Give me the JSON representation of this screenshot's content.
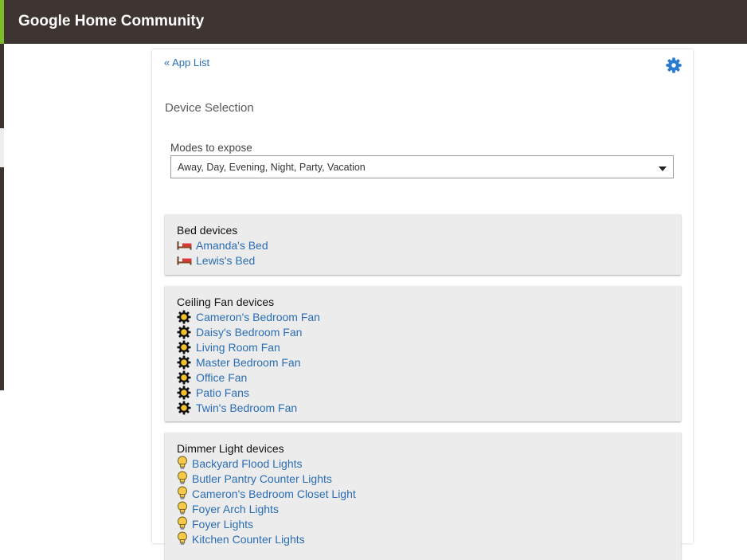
{
  "header": {
    "title": "Google Home Community"
  },
  "panel": {
    "back_link": "« App List",
    "section_title": "Device Selection",
    "modes": {
      "label": "Modes to expose",
      "value": "Away, Day, Evening, Night, Party, Vacation"
    }
  },
  "groups": {
    "bed": {
      "title": "Bed devices",
      "icon": "bed-icon",
      "items": [
        "Amanda's Bed",
        "Lewis's Bed"
      ]
    },
    "fan": {
      "title": "Ceiling Fan devices",
      "icon": "fan-icon",
      "items": [
        "Cameron's Bedroom Fan",
        "Daisy's Bedroom Fan",
        "Living Room Fan",
        "Master Bedroom Fan",
        "Office Fan",
        "Patio Fans",
        "Twin's Bedroom Fan"
      ]
    },
    "dimmer": {
      "title": "Dimmer Light devices",
      "icon": "bulb-icon",
      "items": [
        "Backyard Flood Lights",
        "Butler Pantry Counter Lights",
        "Cameron's Bedroom Closet Light",
        "Foyer Arch Lights",
        "Foyer Lights",
        "Kitchen Counter Lights"
      ]
    }
  },
  "colors": {
    "topbar": "#3e3431",
    "accent": "#7bbe2a",
    "link": "#2a6db4",
    "gear": "#2a7bd0",
    "group_bg": "#ececec"
  }
}
